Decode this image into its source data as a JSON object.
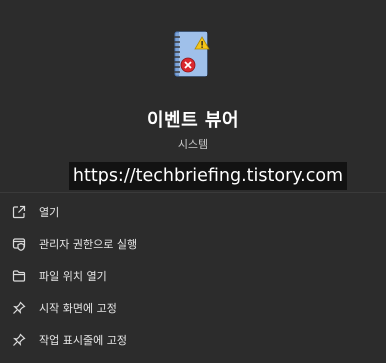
{
  "app": {
    "name": "이벤트 뷰어",
    "type": "시스템"
  },
  "watermark": "https://techbriefing.tistory.com",
  "menu": {
    "items": [
      {
        "label": "열기",
        "icon": "open-external-icon"
      },
      {
        "label": "관리자 권한으로 실행",
        "icon": "run-as-admin-shield-icon"
      },
      {
        "label": "파일 위치 열기",
        "icon": "folder-icon"
      },
      {
        "label": "시작 화면에 고정",
        "icon": "pin-icon"
      },
      {
        "label": "작업 표시줄에 고정",
        "icon": "pin-icon"
      }
    ]
  }
}
